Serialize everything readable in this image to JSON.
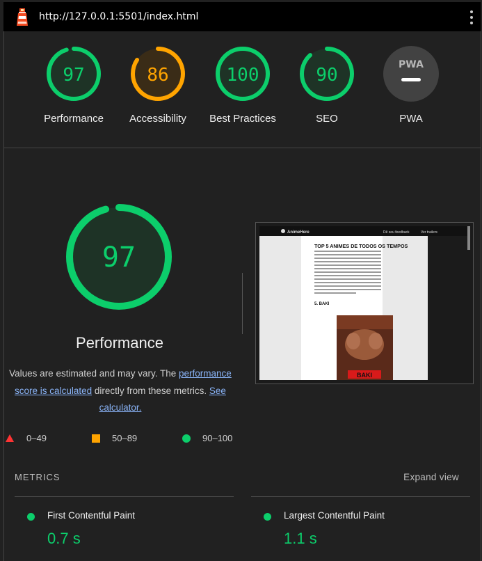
{
  "browser": {
    "url": "http://127.0.0.1:5501/index.html",
    "icon": "lighthouse-icon",
    "menu_icon": "kebab-menu-icon"
  },
  "gauges": [
    {
      "label": "Performance",
      "score": 97,
      "color": "#0cce6b",
      "bg": "#1e3326"
    },
    {
      "label": "Accessibility",
      "score": 86,
      "color": "#ffa400",
      "bg": "#3a2c17"
    },
    {
      "label": "Best Practices",
      "score": 100,
      "color": "#0cce6b",
      "bg": "#1e3326"
    },
    {
      "label": "SEO",
      "score": 90,
      "color": "#0cce6b",
      "bg": "#1e3326"
    },
    {
      "label": "PWA",
      "badge_text": "PWA",
      "color": "#b0b0b0",
      "bg": "#424242"
    }
  ],
  "main": {
    "score": 97,
    "title": "Performance",
    "desc_prefix": "Values are estimated and may vary. The ",
    "desc_link1": "performance score is calculated",
    "desc_middle": " directly from these metrics. ",
    "desc_link2": "See calculator."
  },
  "legend": {
    "fail": "0–49",
    "average": "50–89",
    "pass": "90–100"
  },
  "metrics": {
    "heading": "METRICS",
    "expand": "Expand view",
    "items": [
      {
        "name": "First Contentful Paint",
        "value": "0.7 s",
        "status": "pass"
      },
      {
        "name": "Largest Contentful Paint",
        "value": "1.1 s",
        "status": "pass"
      }
    ]
  },
  "screenshot": {
    "site_name": "AnimeHere",
    "nav1": "Dê seu feedback",
    "nav2": "Ver trailers",
    "heading": "TOP 5 ANIMES DE TODOS OS TEMPOS",
    "section": "5. BAKI",
    "poster_title": "BAKI"
  },
  "colors": {
    "pass": "#0cce6b",
    "average": "#ffa400",
    "fail": "#ff3333",
    "link": "#8ab4f8"
  }
}
